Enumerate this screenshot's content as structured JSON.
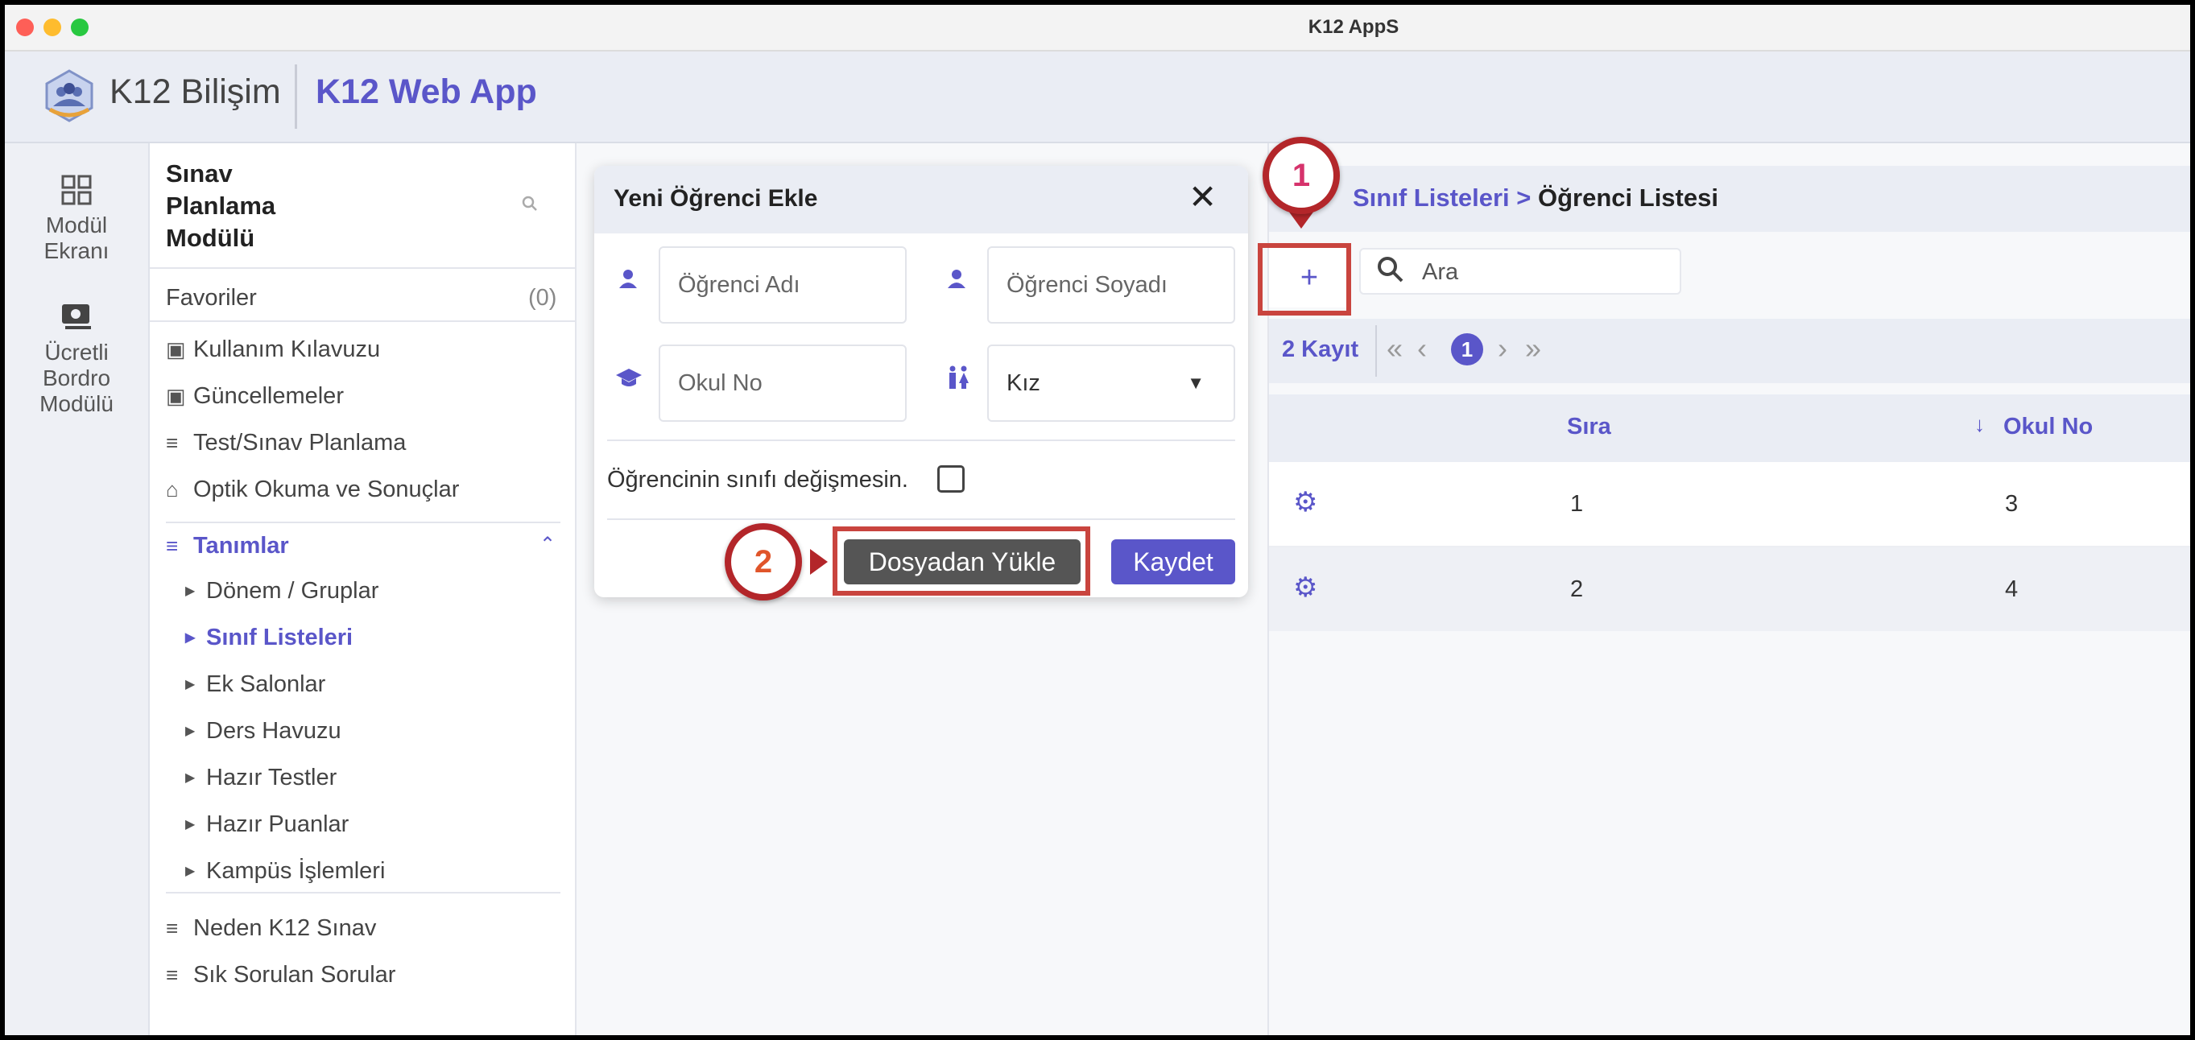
{
  "window": {
    "title": "K12 AppS"
  },
  "header": {
    "brand": "K12 Bilişim",
    "app_name": "K12 Web App"
  },
  "rail": {
    "items": [
      {
        "label_lines": [
          "Modül",
          "Ekranı"
        ],
        "icon": "grid-icon"
      },
      {
        "label_lines": [
          "Ücretli",
          "Bordro",
          "Modülü"
        ],
        "icon": "money-icon"
      }
    ]
  },
  "sidebar": {
    "module_title_lines": [
      "Sınav",
      "Planlama",
      "Modülü"
    ],
    "favorites_label": "Favoriler",
    "favorites_count": "(0)",
    "items": [
      {
        "label": "Kullanım Kılavuzu",
        "icon": "book-icon"
      },
      {
        "label": "Güncellemeler",
        "icon": "book-icon"
      },
      {
        "label": "Test/Sınav Planlama",
        "icon": "menu-icon"
      },
      {
        "label": "Optik Okuma ve Sonuçlar",
        "icon": "scanner-icon"
      }
    ],
    "section": {
      "label": "Tanımlar",
      "icon": "list-add-icon"
    },
    "sub_items": [
      "Dönem / Gruplar",
      "Sınıf Listeleri",
      "Ek Salonlar",
      "Ders Havuzu",
      "Hazır Testler",
      "Hazır Puanlar",
      "Kampüs İşlemleri"
    ],
    "active_sub": "Sınıf Listeleri",
    "footer_items": [
      "Neden K12 Sınav",
      "Sık Sorulan Sorular"
    ]
  },
  "dialog": {
    "title": "Yeni Öğrenci Ekle",
    "first_name_placeholder": "Öğrenci Adı",
    "last_name_placeholder": "Öğrenci Soyadı",
    "school_no_placeholder": "Okul No",
    "gender_value": "Kız",
    "keep_class_label": "Öğrencinin sınıfı değişmesin.",
    "upload_button": "Dosyadan Yükle",
    "save_button": "Kaydet"
  },
  "main": {
    "breadcrumb_link": "Sınıf Listeleri >",
    "breadcrumb_current": "Öğrenci Listesi",
    "add_label": "+",
    "search_placeholder": "Ara",
    "record_count": "2 Kayıt",
    "page": "1",
    "columns": [
      "Sıra",
      "Okul No"
    ],
    "rows": [
      {
        "sira": "1",
        "okul_no": "3"
      },
      {
        "sira": "2",
        "okul_no": "4"
      }
    ]
  },
  "callouts": [
    "1",
    "2"
  ],
  "colors": {
    "accent": "#5a56c9",
    "callout": "#c9443e",
    "callout_badge": "#b3262a"
  }
}
